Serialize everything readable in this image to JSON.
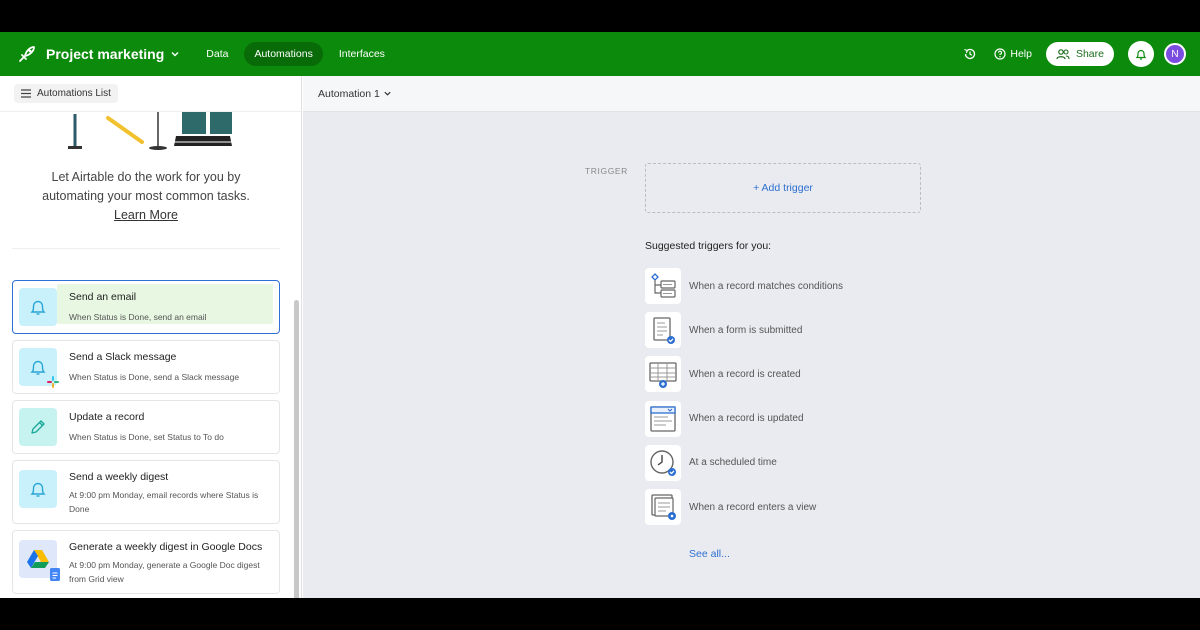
{
  "header": {
    "base_name": "Project marketing",
    "nav": [
      "Data",
      "Automations",
      "Interfaces"
    ],
    "help_label": "Help",
    "share_label": "Share",
    "avatar_initial": "N",
    "brand_color": "#0b8a0b"
  },
  "sidebar": {
    "list_button": "Automations List",
    "intro": "Let Airtable do the work for you by automating your most common tasks.",
    "learn_more": "Learn More",
    "templates": [
      {
        "title": "Send an email",
        "subtitle": "When Status is Done, send an email",
        "icon": "bell-icon"
      },
      {
        "title": "Send a Slack message",
        "subtitle": "When Status is Done, send a Slack message",
        "icon": "bell-slack-icon"
      },
      {
        "title": "Update a record",
        "subtitle": "When Status is Done, set Status to To do",
        "icon": "pencil-icon"
      },
      {
        "title": "Send a weekly digest",
        "subtitle": "At 9:00 pm Monday, email records where Status is Done",
        "icon": "bell-icon"
      },
      {
        "title": "Generate a weekly digest in Google Docs",
        "subtitle": "At 9:00 pm Monday, generate a Google Doc digest from Grid view",
        "icon": "google-drive-icon"
      }
    ]
  },
  "main": {
    "automation_name": "Automation 1",
    "trigger_label": "TRIGGER",
    "add_trigger": "+ Add trigger",
    "suggested_title": "Suggested triggers for you:",
    "suggestions": [
      {
        "label": "When a record matches conditions",
        "icon": "conditions-icon"
      },
      {
        "label": "When a form is submitted",
        "icon": "form-icon"
      },
      {
        "label": "When a record is created",
        "icon": "record-created-icon"
      },
      {
        "label": "When a record is updated",
        "icon": "record-updated-icon"
      },
      {
        "label": "At a scheduled time",
        "icon": "clock-icon"
      },
      {
        "label": "When a record enters a view",
        "icon": "record-view-icon"
      }
    ],
    "see_all": "See all..."
  }
}
